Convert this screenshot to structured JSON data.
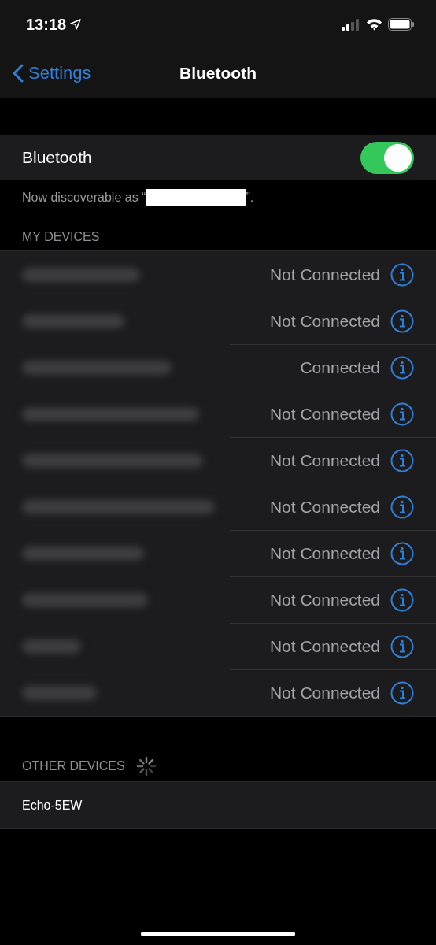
{
  "status_bar": {
    "time": "13:18"
  },
  "nav": {
    "back": "Settings",
    "title": "Bluetooth"
  },
  "bluetooth": {
    "label": "Bluetooth",
    "on": true,
    "note_before": "Now discoverable as “",
    "note_after": "”."
  },
  "my_devices": {
    "header": "MY DEVICES",
    "devices": [
      {
        "status": "Not Connected"
      },
      {
        "status": "Not Connected"
      },
      {
        "status": "Connected"
      },
      {
        "status": "Not Connected"
      },
      {
        "status": "Not Connected"
      },
      {
        "status": "Not Connected"
      },
      {
        "status": "Not Connected"
      },
      {
        "status": "Not Connected"
      },
      {
        "status": "Not Connected"
      },
      {
        "status": "Not Connected"
      }
    ]
  },
  "other_devices": {
    "header": "OTHER DEVICES",
    "searching": true,
    "devices": [
      {
        "name": "Echo-5EW"
      }
    ]
  }
}
